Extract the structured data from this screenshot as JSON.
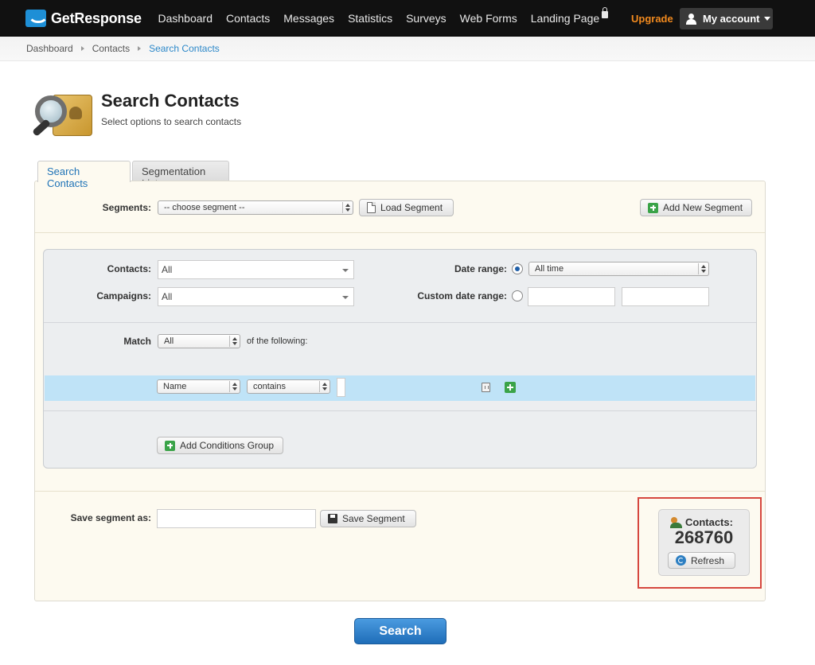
{
  "brand": {
    "name": "GetResponse"
  },
  "nav": {
    "items": [
      "Dashboard",
      "Contacts",
      "Messages",
      "Statistics",
      "Surveys",
      "Web Forms",
      "Landing Page"
    ],
    "upgrade": "Upgrade",
    "account": "My account"
  },
  "breadcrumb": [
    "Dashboard",
    "Contacts",
    "Search Contacts"
  ],
  "header": {
    "title": "Search Contacts",
    "subtitle": "Select options to search contacts"
  },
  "tabs": [
    "Search Contacts",
    "Segmentation List"
  ],
  "segments": {
    "label": "Segments:",
    "selected": "-- choose segment --",
    "load_button": "Load Segment",
    "add_button": "Add New Segment"
  },
  "filters": {
    "contacts_label": "Contacts:",
    "contacts_value": "All",
    "campaigns_label": "Campaigns:",
    "campaigns_value": "All",
    "date_range_label": "Date range:",
    "date_range_value": "All time",
    "custom_range_label": "Custom date range:",
    "match_label": "Match",
    "match_value": "All",
    "match_suffix": "of the following:",
    "condition": {
      "field": "Name",
      "operator": "contains",
      "value": ""
    },
    "add_group_button": "Add Conditions Group"
  },
  "save": {
    "label": "Save segment as:",
    "value": "",
    "button": "Save Segment"
  },
  "contacts_box": {
    "label": "Contacts:",
    "count": "268760",
    "refresh": "Refresh"
  },
  "search_button": "Search",
  "colors": {
    "accent": "#2c88c9",
    "upgrade": "#f28a1e",
    "highlight": "#d6473f",
    "condition_row": "#bfe3f7"
  }
}
